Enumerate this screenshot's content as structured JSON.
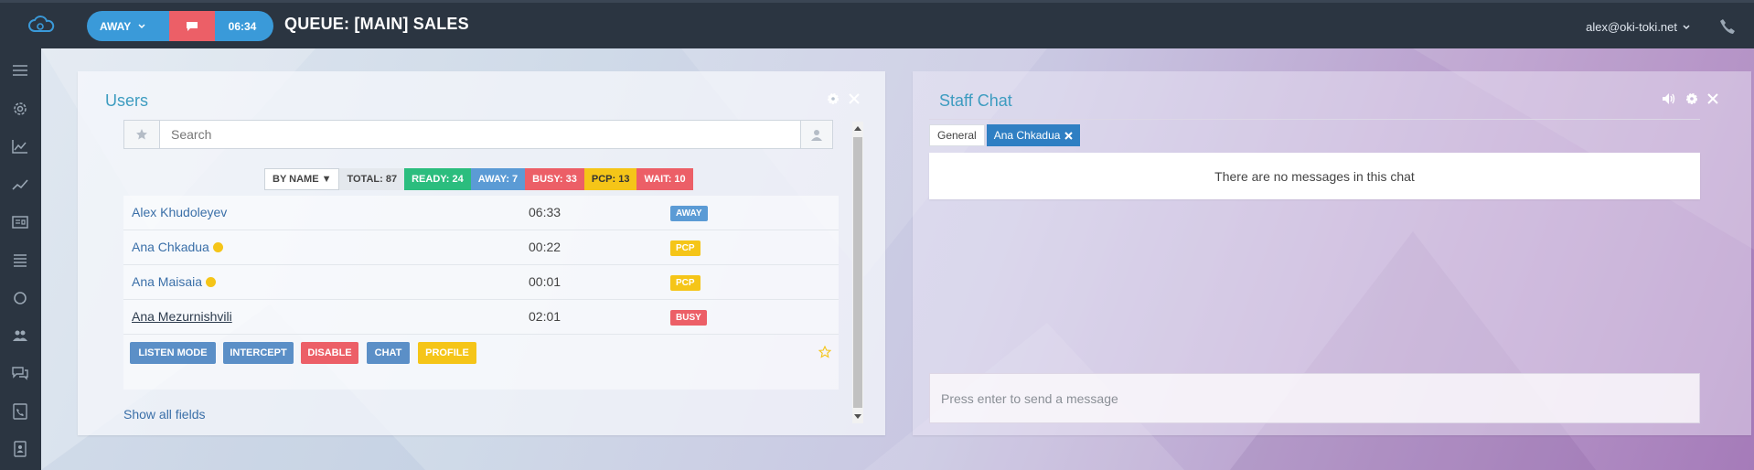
{
  "header": {
    "status_label": "AWAY",
    "timer": "06:34",
    "queue_title": "QUEUE: [MAIN] SALES",
    "user_email": "alex@oki-toki.net"
  },
  "sidebar": {
    "items": [
      "menu-icon",
      "gear-icon",
      "area-chart-icon",
      "line-chart-icon",
      "id-card-icon",
      "list-icon",
      "circle-icon",
      "users-icon",
      "chat-bubbles-icon",
      "phone-book-icon",
      "address-book-icon"
    ]
  },
  "users_panel": {
    "title": "Users",
    "search_placeholder": "Search",
    "sort_label": "BY NAME ▼",
    "stats": {
      "total": "TOTAL: 87",
      "ready": "READY: 24",
      "away": "AWAY: 7",
      "busy": "BUSY: 33",
      "pcp": "PCP: 13",
      "wait": "WAIT: 10"
    },
    "rows": [
      {
        "name": "Alex Khudoleyev",
        "time": "06:33",
        "status": "AWAY"
      },
      {
        "name": "Ana Chkadua",
        "time": "00:22",
        "status": "PCP"
      },
      {
        "name": "Ana Maisaia",
        "time": "00:01",
        "status": "PCP"
      },
      {
        "name": "Ana Mezurnishvili",
        "time": "02:01",
        "status": "BUSY"
      }
    ],
    "actions": {
      "listen": "LISTEN MODE",
      "intercept": "INTERCEPT",
      "disable": "DISABLE",
      "chat": "CHAT",
      "profile": "PROFILE"
    },
    "show_all": "Show all fields"
  },
  "chat_panel": {
    "title": "Staff Chat",
    "tabs": {
      "general": "General",
      "active": "Ana Chkadua"
    },
    "empty_message": "There are no messages in this chat",
    "input_placeholder": "Press enter to send a message"
  },
  "colors": {
    "accent": "#3a9ad9",
    "ready": "#2bbd7e",
    "busy": "#ec5f67",
    "pcp": "#f5c518",
    "away": "#5b9bd5"
  }
}
